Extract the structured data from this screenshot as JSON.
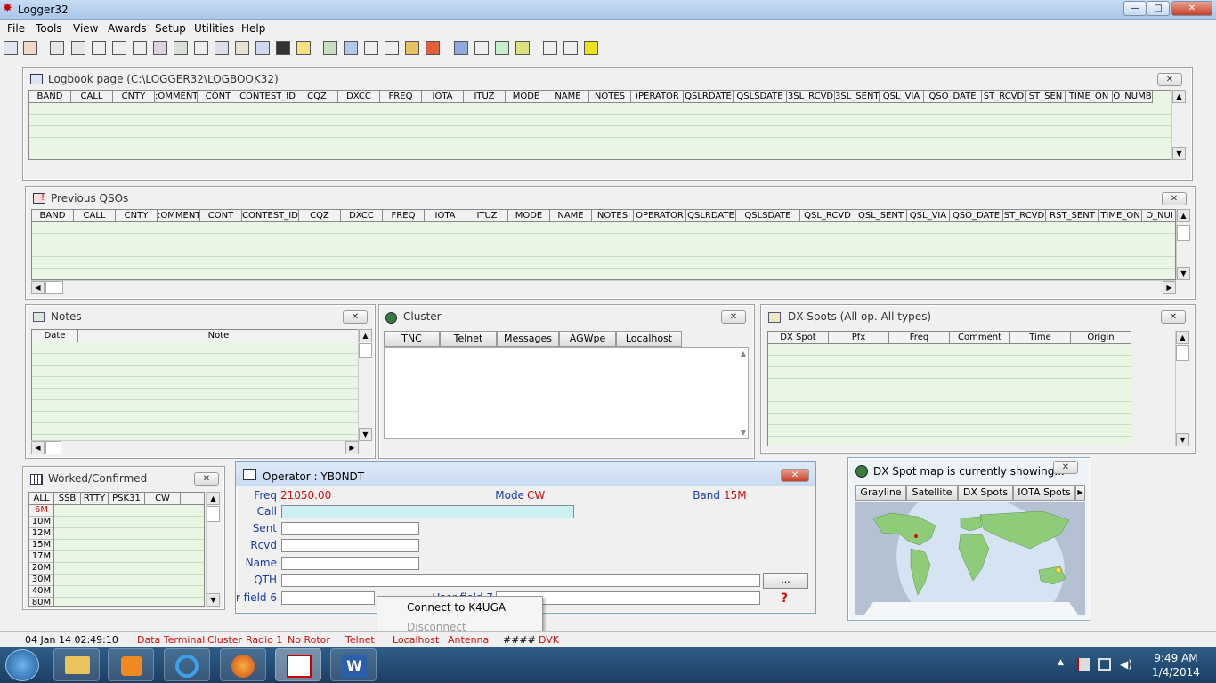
{
  "app": {
    "title": "Logger32"
  },
  "window_controls": {
    "minimize": "—",
    "maximize": "□",
    "close": "✕"
  },
  "menu": [
    "File",
    "Tools",
    "View",
    "Awards",
    "Setup",
    "Utilities",
    "Help"
  ],
  "logbook": {
    "title": "Logbook page (C:\\LOGGER32\\LOGBOOK32)",
    "columns": [
      "BAND",
      "CALL",
      "CNTY",
      ":OMMENT",
      "CONT",
      "CONTEST_ID",
      "CQZ",
      "DXCC",
      "FREQ",
      "IOTA",
      "ITUZ",
      "MODE",
      "NAME",
      "NOTES",
      ")PERATOR",
      "QSLRDATE",
      "QSLSDATE",
      "3SL_RCVD",
      "3SL_SENT",
      "QSL_VIA",
      "QSO_DATE",
      "ST_RCVD",
      "ST_SEN",
      "TIME_ON",
      "O_NUMB"
    ]
  },
  "previous_qsos": {
    "title": "Previous QSOs",
    "columns": [
      "BAND",
      "CALL",
      "CNTY",
      ":OMMENT",
      "CONT",
      "CONTEST_ID",
      "CQZ",
      "DXCC",
      "FREQ",
      "IOTA",
      "ITUZ",
      "MODE",
      "NAME",
      "NOTES",
      "OPERATOR",
      "QSLRDATE",
      "QSLSDATE",
      "QSL_RCVD",
      "QSL_SENT",
      "QSL_VIA",
      "QSO_DATE",
      "ST_RCVD",
      "RST_SENT",
      "TIME_ON",
      "O_NUI"
    ]
  },
  "notes": {
    "title": "Notes",
    "columns": [
      "Date",
      "Note"
    ]
  },
  "cluster": {
    "title": "Cluster",
    "tabs": [
      "TNC",
      "Telnet",
      "Messages",
      "AGWpe",
      "Localhost"
    ]
  },
  "dx_spots": {
    "title": "DX Spots (All op. All types)",
    "columns": [
      "DX Spot",
      "Pfx",
      "Freq",
      "Comment",
      "Time",
      "Origin"
    ]
  },
  "worked": {
    "title": "Worked/Confirmed",
    "columns": [
      "ALL",
      "SSB",
      "RTTY",
      "PSK31",
      "CW"
    ],
    "bands": [
      "6M",
      "10M",
      "12M",
      "15M",
      "17M",
      "20M",
      "30M",
      "40M",
      "80M"
    ]
  },
  "operator": {
    "title": "Operator : YB0NDT",
    "freq_label": "Freq",
    "freq_value": "21050.00",
    "mode_label": "Mode",
    "mode_value": "CW",
    "band_label": "Band",
    "band_value": "15M",
    "fields": [
      "Call",
      "Sent",
      "Rcvd",
      "Name",
      "QTH"
    ],
    "field6": "r field 6",
    "field7": "User field 7",
    "more_button": "...",
    "help": "?"
  },
  "context_menu": {
    "connect": "Connect to K4UGA",
    "disconnect": "Disconnect"
  },
  "dx_map": {
    "title": "DX Spot map is currently showing...",
    "tabs": [
      "Grayline",
      "Satellite",
      "DX Spots",
      "IOTA Spots"
    ]
  },
  "statusbar": {
    "datetime": "04 Jan 14  02:49:10",
    "items": [
      "Data Terminal",
      "Cluster",
      "Radio 1",
      "No Rotor",
      "Telnet",
      "Localhost",
      "Antenna",
      "####",
      "DVK"
    ]
  },
  "taskbar": {
    "time": "9:49 AM",
    "date": "1/4/2014"
  },
  "colors": {
    "title_blue": "#1a3aa8",
    "value_red": "#d01010",
    "grid_green": "#eaf6e4"
  }
}
